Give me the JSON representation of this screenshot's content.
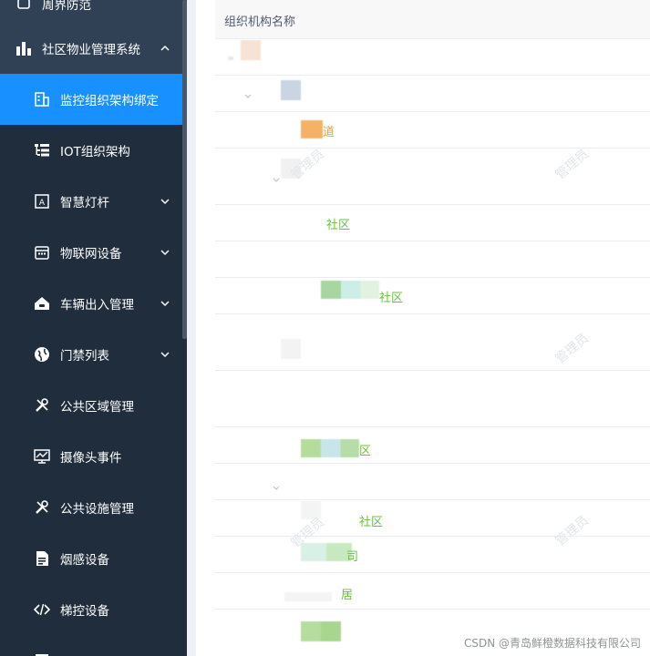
{
  "sidebar": {
    "top_partial_label": "周界防范",
    "group_label": "社区物业管理系统",
    "items": [
      {
        "label": "监控组织架构绑定",
        "icon": "building-icon",
        "active": true,
        "has_children": false
      },
      {
        "label": "IOT组织架构",
        "icon": "tree-list-icon",
        "active": false,
        "has_children": false
      },
      {
        "label": "智慧灯杆",
        "icon": "lamp-post-icon",
        "active": false,
        "has_children": true
      },
      {
        "label": "物联网设备",
        "icon": "calendar-icon",
        "active": false,
        "has_children": true
      },
      {
        "label": "车辆出入管理",
        "icon": "car-home-icon",
        "active": false,
        "has_children": true
      },
      {
        "label": "门禁列表",
        "icon": "globe-icon",
        "active": false,
        "has_children": true
      },
      {
        "label": "公共区域管理",
        "icon": "tools-icon",
        "active": false,
        "has_children": false
      },
      {
        "label": "摄像头事件",
        "icon": "monitor-chart-icon",
        "active": false,
        "has_children": false
      },
      {
        "label": "公共设施管理",
        "icon": "tools-icon",
        "active": false,
        "has_children": false
      },
      {
        "label": "烟感设备",
        "icon": "document-icon",
        "active": false,
        "has_children": false
      },
      {
        "label": "梯控设备",
        "icon": "code-icon",
        "active": false,
        "has_children": false
      }
    ]
  },
  "table": {
    "column_header": "组织机构名称",
    "rows": [
      {
        "text": ""
      },
      {
        "text": ""
      },
      {
        "text": "道"
      },
      {
        "text": ""
      },
      {
        "text": "社区"
      },
      {
        "text": ""
      },
      {
        "text": "社区"
      },
      {
        "text": ""
      },
      {
        "text": ""
      },
      {
        "text": "区"
      },
      {
        "text": ""
      },
      {
        "text": "社区"
      },
      {
        "text": "司"
      },
      {
        "text": "居"
      },
      {
        "text": ""
      }
    ]
  },
  "watermark": {
    "text": "管理员"
  },
  "footer_watermark": "CSDN @青岛鲜橙数据科技有限公司",
  "colors": {
    "sidebar_bg": "#304156",
    "submenu_bg": "#1f2d3d",
    "active": "#1890ff",
    "link_orange": "#e6a23c",
    "link_green": "#67c23a"
  }
}
